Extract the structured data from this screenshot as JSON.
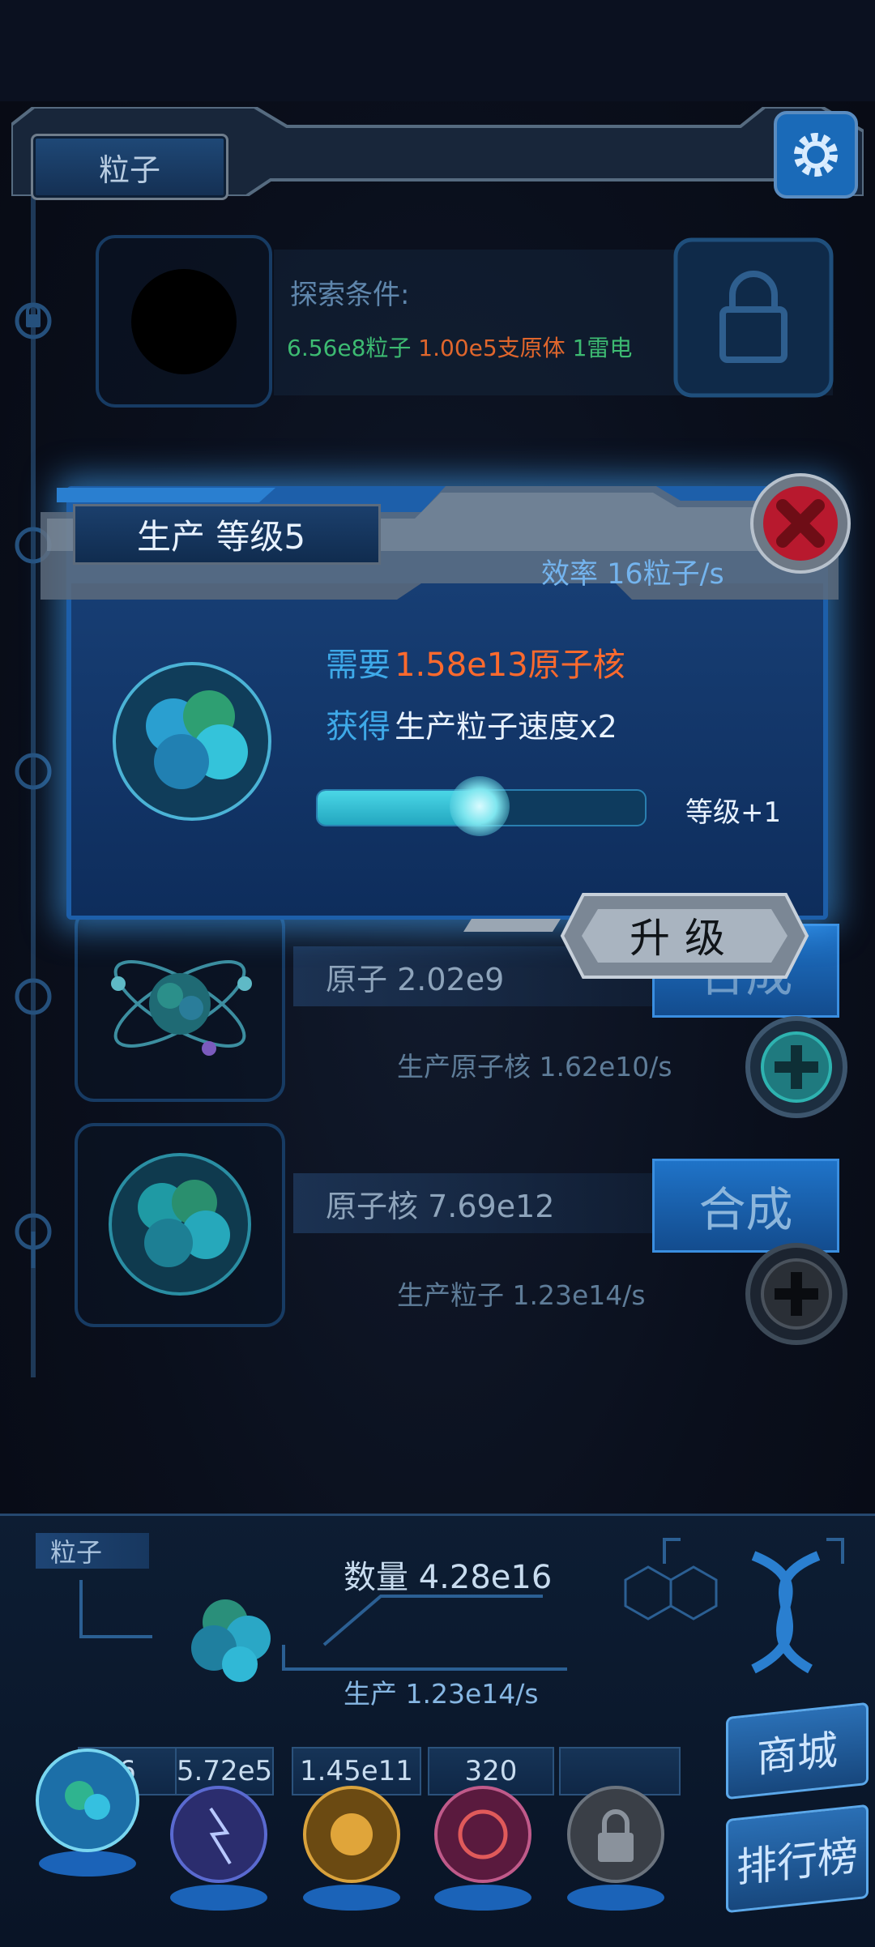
{
  "header": {
    "title": "粒子"
  },
  "explore": {
    "label": "探索条件:",
    "cond1": "6.56e8粒子",
    "cond2": "1.00e5支原体",
    "cond3": "1雷电"
  },
  "atom": {
    "label": "原子 2.02e9",
    "produce": "生产原子核 1.62e10/s",
    "merge": "合成"
  },
  "nucleus": {
    "label": "原子核 7.69e12",
    "produce": "生产粒子 1.23e14/s",
    "merge": "合成"
  },
  "modal": {
    "title": "生产 等级5",
    "efficiency": "效率 16粒子/s",
    "need_label": "需要",
    "need_value": "1.58e13原子核",
    "gain_label": "获得",
    "gain_value": "生产粒子速度x2",
    "level_plus": "等级+1",
    "progress": 0.5,
    "upgrade": "升级"
  },
  "bottom": {
    "tag": "粒子",
    "count": "数量 4.28e16",
    "produce": "生产 1.23e14/s",
    "resources": [
      "6",
      "5.72e5",
      "1.45e11",
      "320",
      ""
    ],
    "shop": "商城",
    "ranking": "排行榜"
  },
  "colors": {
    "accent": "#1f73c8",
    "highlight": "#ff6a2d",
    "green": "#3dbb72",
    "cyan": "#4ad6e6"
  }
}
